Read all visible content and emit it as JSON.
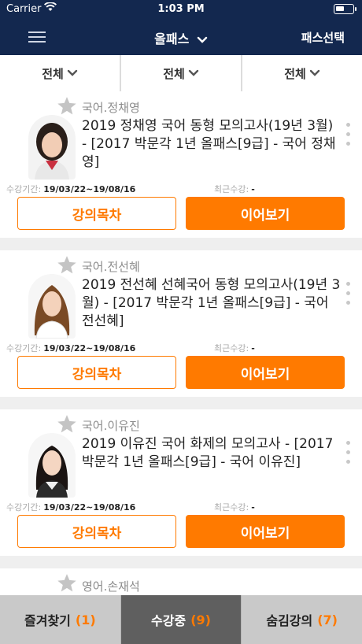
{
  "status_bar": {
    "carrier": "Carrier",
    "time": "1:03 PM"
  },
  "nav": {
    "title": "올패스",
    "pass_select": "패스선택"
  },
  "filters": [
    "전체",
    "전체",
    "전체"
  ],
  "meta_labels": {
    "period": "수강기간:",
    "recent": "최근수강:"
  },
  "buttons": {
    "toc": "강의목차",
    "continue": "이어보기"
  },
  "courses": [
    {
      "teacher": "국어.정채영",
      "title": "2019 정채영 국어 동형 모의고사(19년 3월) - [2017 박문각 1년 올패스[9급] - 국어 정채영]",
      "period": "19/03/22~19/08/16",
      "recent": "-"
    },
    {
      "teacher": "국어.전선혜",
      "title": "2019 전선혜 선혜국어 동형 모의고사(19년 3월) - [2017 박문각 1년 올패스[9급] - 국어 전선혜]",
      "period": "19/03/22~19/08/16",
      "recent": "-"
    },
    {
      "teacher": "국어.이유진",
      "title": "2019 이유진 국어 화제의 모의고사 - [2017 박문각 1년 올패스[9급] - 국어 이유진]",
      "period": "19/03/22~19/08/16",
      "recent": "-"
    }
  ],
  "partial_course": {
    "teacher": "영어.손재석"
  },
  "tabs": [
    {
      "label": "즐겨찾기",
      "count": "(1)",
      "active": false
    },
    {
      "label": "수강중",
      "count": "(9)",
      "active": true
    },
    {
      "label": "숨김강의",
      "count": "(7)",
      "active": false
    }
  ],
  "colors": {
    "nav_bg": "#13284f",
    "accent": "#ff7a00",
    "tab_active": "#5f5f5f",
    "tab_inactive": "#c9c9c9"
  }
}
